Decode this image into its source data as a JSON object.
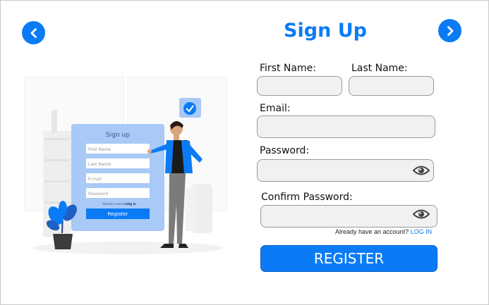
{
  "header": {
    "title": "Sign Up",
    "back_icon": "chevron-left-icon",
    "forward_icon": "chevron-right-icon"
  },
  "form": {
    "first_name_label": "First Name:",
    "last_name_label": "Last Name:",
    "email_label": "Email:",
    "password_label": "Password:",
    "confirm_password_label": "Confirm Password:",
    "first_name_value": "",
    "last_name_value": "",
    "email_value": "",
    "password_value": "",
    "confirm_password_value": "",
    "eye_icon": "eye-icon"
  },
  "footer": {
    "account_prompt": "Already have an account?",
    "login_link": "LOG IN"
  },
  "register_label": "REGISTER",
  "illustration": {
    "card_title": "Sign up",
    "first_name_placeholder": "First Name",
    "last_name_placeholder": "Last Name",
    "email_placeholder": "E-mail",
    "password_placeholder": "Password",
    "member_prompt": "Already a member?",
    "member_link": "Log in",
    "button_label": "Register"
  },
  "colors": {
    "accent": "#0a7bf5",
    "field_bg": "#f1f1f1",
    "card_bg": "#a9c9f7"
  }
}
